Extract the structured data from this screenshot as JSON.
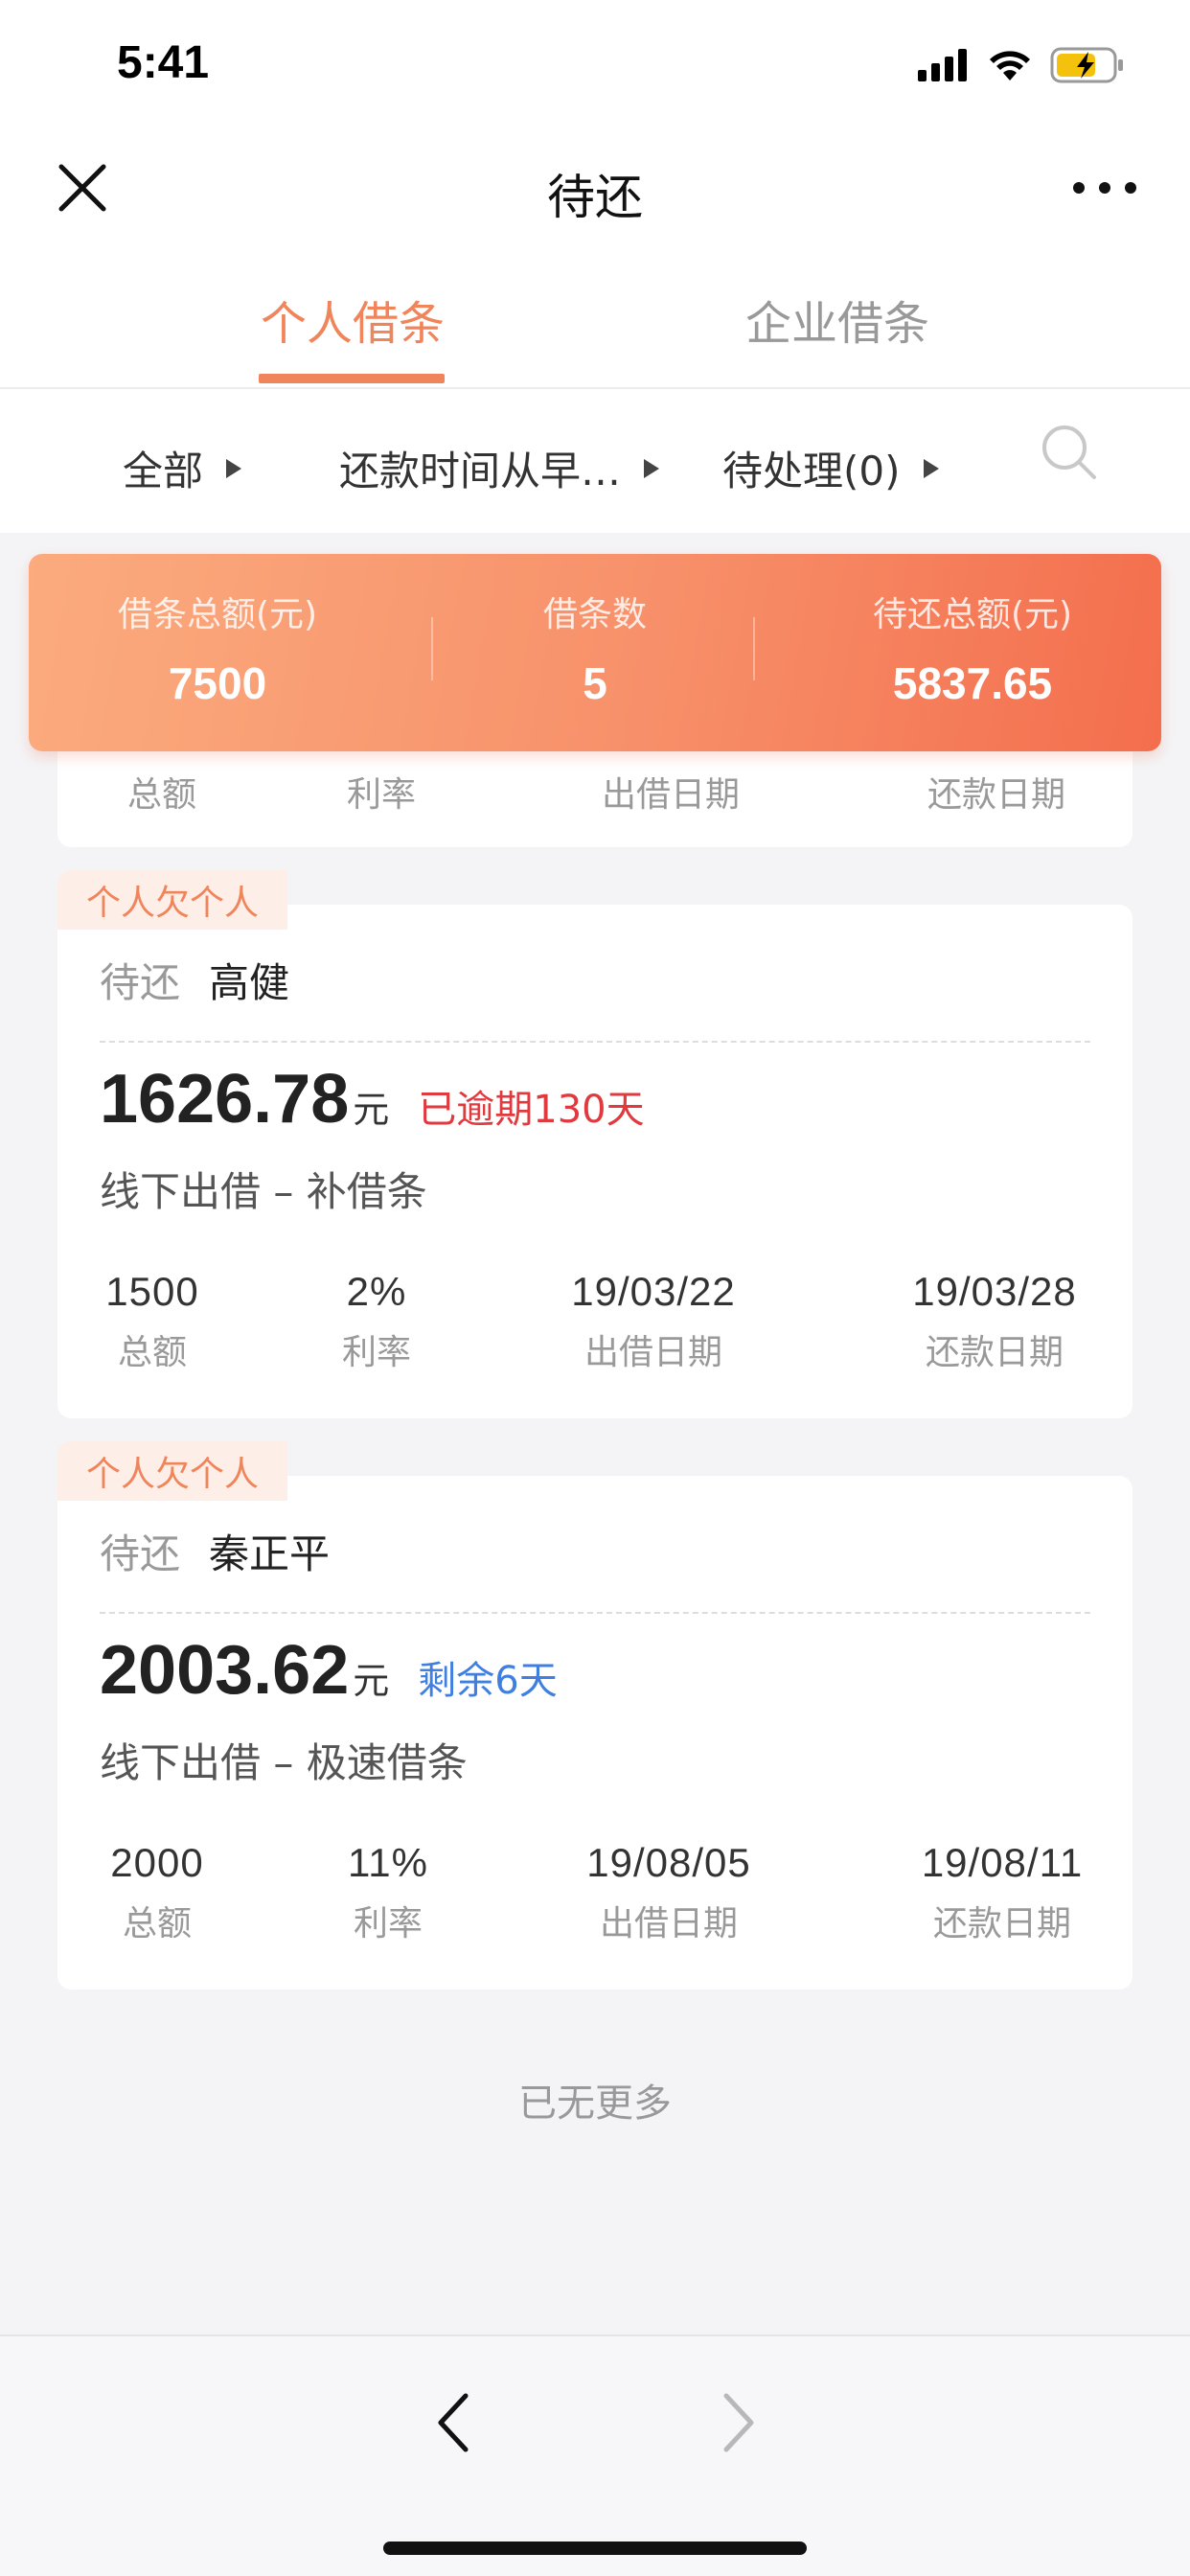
{
  "status_bar": {
    "time": "5:41"
  },
  "nav": {
    "title": "待还"
  },
  "tabs": [
    {
      "label": "个人借条",
      "active": true
    },
    {
      "label": "企业借条",
      "active": false
    }
  ],
  "filters": {
    "all": "全部",
    "sort": "还款时间从早…",
    "status": "待处理(0)"
  },
  "summary": {
    "total_amount_label": "借条总额(元)",
    "total_amount": "7500",
    "count_label": "借条数",
    "count": "5",
    "outstanding_label": "待还总额(元)",
    "outstanding": "5837.65"
  },
  "partial_card": {
    "labels": [
      "总额",
      "利率",
      "出借日期",
      "还款日期"
    ]
  },
  "loans": [
    {
      "tag": "个人欠个人",
      "label": "待还",
      "name": "高健",
      "amount": "1626.78",
      "unit": "元",
      "status": "已逾期130天",
      "channel": "线下出借 – 补借条",
      "principal": "1500",
      "principal_label": "总额",
      "rate": "2%",
      "rate_label": "利率",
      "lend_date": "19/03/22",
      "lend_date_label": "出借日期",
      "due_date": "19/03/28",
      "due_date_label": "还款日期"
    },
    {
      "tag": "个人欠个人",
      "label": "待还",
      "name": "秦正平",
      "amount": "2003.62",
      "unit": "元",
      "status": "剩余6天",
      "channel": "线下出借 – 极速借条",
      "principal": "2000",
      "principal_label": "总额",
      "rate": "11%",
      "rate_label": "利率",
      "lend_date": "19/08/05",
      "lend_date_label": "出借日期",
      "due_date": "19/08/11",
      "due_date_label": "还款日期"
    }
  ],
  "footer_text": "已无更多",
  "colors": {
    "accent": "#f0845a",
    "overdue": "#e0393e",
    "remaining": "#3f7fe0"
  }
}
